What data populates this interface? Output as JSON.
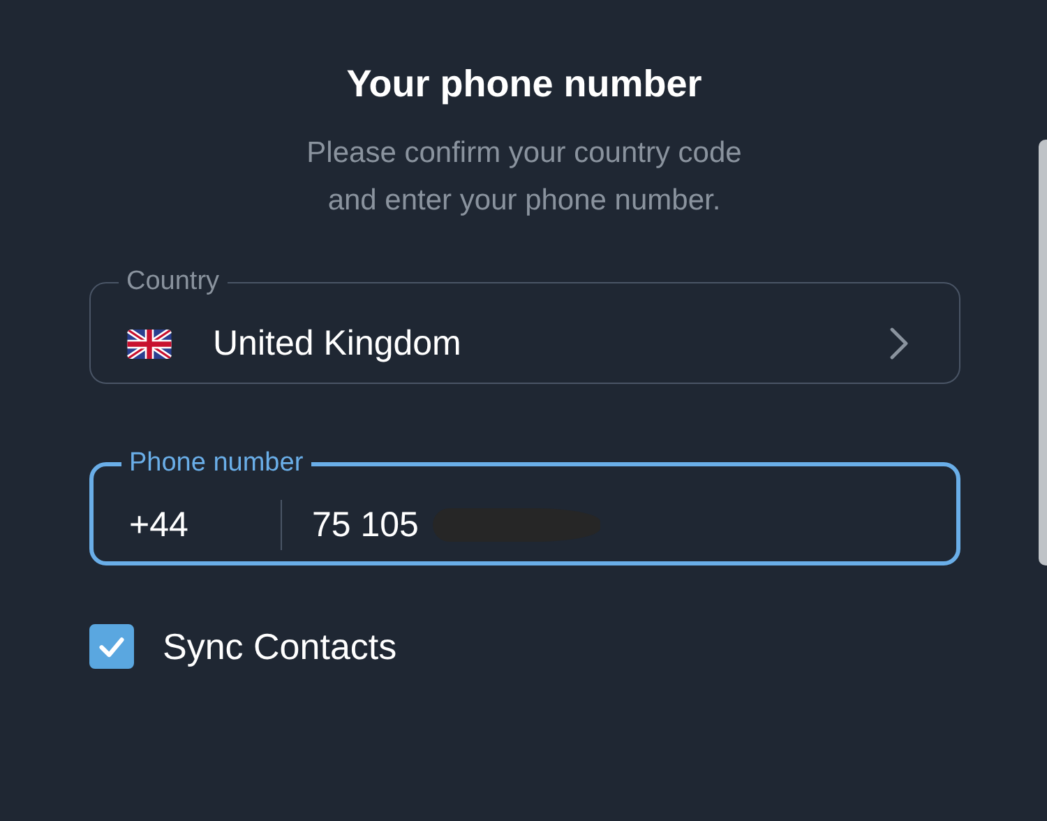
{
  "title": "Your phone number",
  "subtitle": [
    "Please confirm your country code",
    "and enter your phone number."
  ],
  "country": {
    "label": "Country",
    "value": "United Kingdom"
  },
  "phone": {
    "label": "Phone number",
    "prefix": "+44",
    "value": "75 105",
    "focused": true,
    "redacted": true
  },
  "sync_contacts": {
    "label": "Sync Contacts",
    "checked": true
  }
}
